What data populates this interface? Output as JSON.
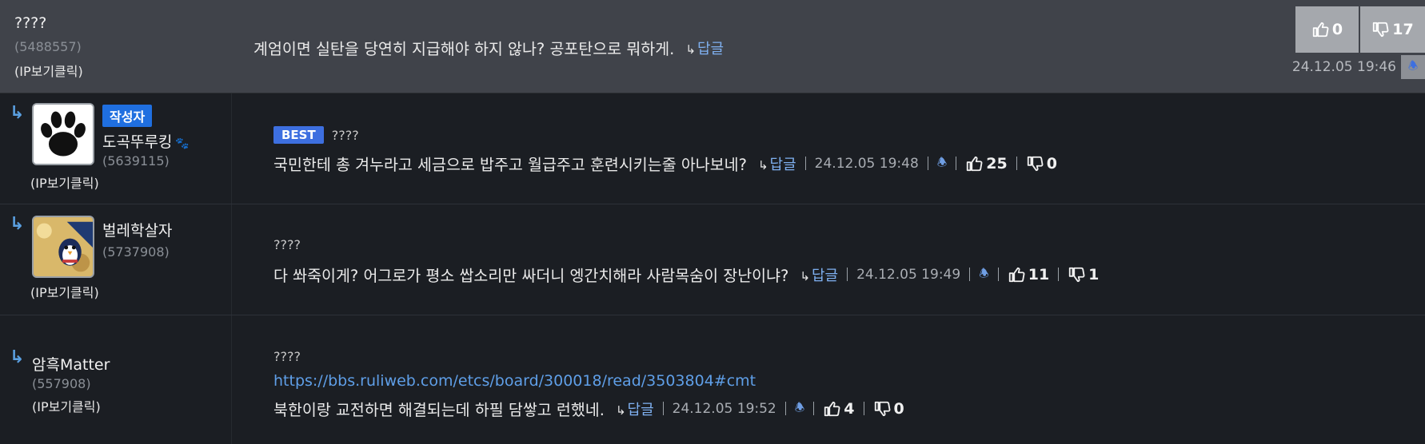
{
  "comments": [
    {
      "username": "????",
      "user_id": "(5488557)",
      "ip_label": "(IP보기클릭)",
      "text": "계엄이면 실탄을 당연히 지급해야 하지 않나? 공포탄으로 뭐하게.",
      "reply_label": "답글",
      "reply_arrow": "↳",
      "timestamp": "24.12.05 19:46",
      "likes": "0",
      "dislikes": "17",
      "bell_icon": "bell-icon"
    },
    {
      "reply_indicator": "↳",
      "author_badge": "작성자",
      "username": "도곡뚜루킹",
      "user_id": "(5639115)",
      "ip_label": "(IP보기클릭)",
      "best_badge": "BEST",
      "meta_name": "????",
      "text": "국민한테 총 겨누라고 세금으로 밥주고 월급주고 훈련시키는줄 아나보네?",
      "reply_label": "답글",
      "reply_arrow": "↳",
      "timestamp": "24.12.05 19:48",
      "likes": "25",
      "dislikes": "0",
      "avatar_icon": "paw-icon"
    },
    {
      "reply_indicator": "↳",
      "username": "벌레학살자",
      "user_id": "(5737908)",
      "ip_label": "(IP보기클릭)",
      "meta_name": "????",
      "text": "다 쏴죽이게? 어그로가 평소 쌉소리만 싸더니 엥간치해라 사람목숨이 장난이냐?",
      "reply_label": "답글",
      "reply_arrow": "↳",
      "timestamp": "24.12.05 19:49",
      "likes": "11",
      "dislikes": "1",
      "avatar_icon": "penguin-icon"
    },
    {
      "reply_indicator": "↳",
      "username": "암흑Matter",
      "user_id": "(557908)",
      "ip_label": "(IP보기클릭)",
      "meta_name": "????",
      "link": "https://bbs.ruliweb.com/etcs/board/300018/read/3503804#cmt",
      "text": "북한이랑 교전하면 해결되는데 하필 담쌓고 런했네.",
      "reply_label": "답글",
      "reply_arrow": "↳",
      "timestamp": "24.12.05 19:52",
      "likes": "4",
      "dislikes": "0"
    }
  ],
  "colors": {
    "background": "#1b1e23",
    "highlight_row": "#40434a",
    "link": "#5f9fe8",
    "badge_blue": "#1f6fe0"
  }
}
